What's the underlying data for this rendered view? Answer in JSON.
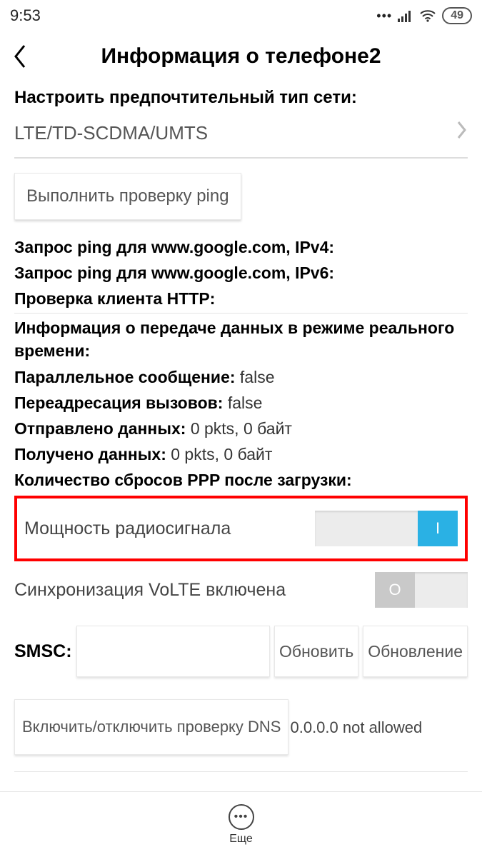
{
  "status": {
    "time": "9:53",
    "battery": "49"
  },
  "header": {
    "title": "Информация о телефоне2"
  },
  "sections": {
    "pref_net_label": "Настроить предпочтительный тип сети:",
    "pref_net_value": "LTE/TD-SCDMA/UMTS",
    "ping_button": "Выполнить проверку ping",
    "ping_ipv4_label": "Запрос ping для www.google.com, IPv4:",
    "ping_ipv6_label": "Запрос ping для www.google.com, IPv6:",
    "http_check_label": "Проверка клиента HTTP:",
    "realtime_header": "Информация о передаче данных в режиме реального времени:",
    "concurrent_label": "Параллельное сообщение:",
    "concurrent_val": "false",
    "call_fwd_label": "Переадресация вызовов:",
    "call_fwd_val": "false",
    "sent_label": "Отправлено данных:",
    "sent_val": "0 pkts, 0 байт",
    "recv_label": "Получено данных:",
    "recv_val": "0 pkts, 0 байт",
    "ppp_reset_label": "Количество сбросов PPP после загрузки:",
    "radio_power_label": "Мощность радиосигнала",
    "radio_power_knob": "I",
    "volte_label": "Синхронизация VoLTE включена",
    "volte_knob": "O",
    "smsc_label": "SMSC:",
    "smsc_refresh": "Обновить",
    "smsc_update": "Обновление",
    "dns_toggle_btn": "Включить/отключить проверку DNS",
    "dns_value": "0.0.0.0 not allowed"
  },
  "bottom": {
    "more_label": "Еще"
  }
}
